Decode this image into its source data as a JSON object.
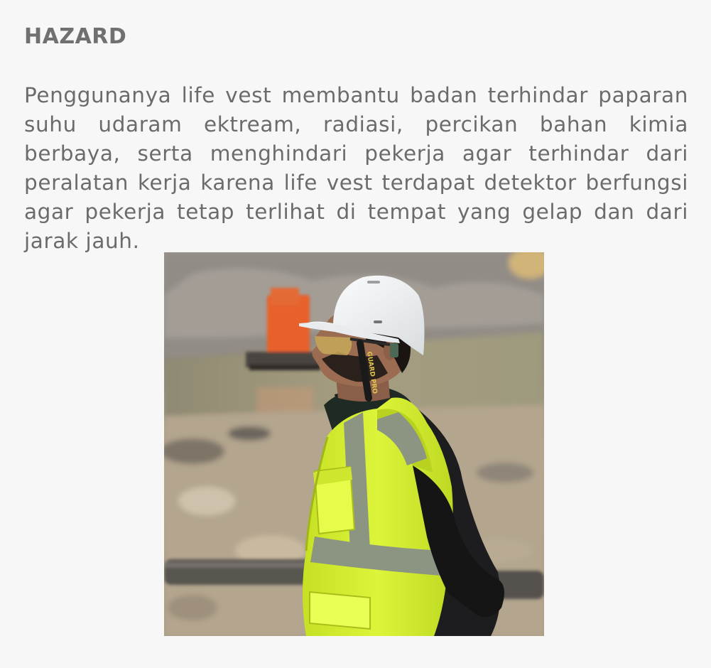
{
  "document": {
    "heading": "HAZARD",
    "paragraph": "Penggunanya life vest membantu badan terhindar paparan suhu udaram ektream, radiasi, percikan bahan kimia berbaya, serta menghindari pekerja agar terhindar dari peralatan kerja karena life vest terdapat detektor berfungsi agar pekerja tetap terlihat di tempat yang gelap dan dari jarak jauh."
  },
  "photo": {
    "helmet_strap_text": "GUARD PRO"
  },
  "colors": {
    "background": "#f7f7f7",
    "heading": "#707070",
    "text": "#6b6b6b",
    "vest": "#d4ef2c",
    "reflective_band": "#8c9582",
    "helmet": "#f3f3f3",
    "excavator": "#e8602c"
  }
}
